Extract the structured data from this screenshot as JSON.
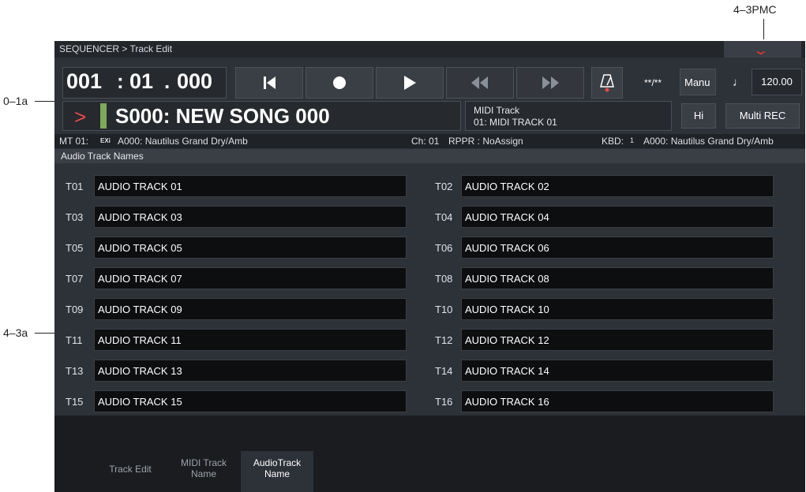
{
  "callouts": {
    "pmc": "4–3PMC",
    "song": "0–1a",
    "tracks": "4–3a"
  },
  "titlebar": {
    "title": "SEQUENCER > Track Edit",
    "pmc_icon": "chevron-down-icon"
  },
  "locator": {
    "measure": "001",
    "beat": "01",
    "tick": "000",
    "colon": ":",
    "dot": "."
  },
  "transport": {
    "meter": "**/**",
    "mode": "Manu",
    "note_symbol": "♩",
    "tempo": "120.00"
  },
  "song": {
    "chevron": ">",
    "name": "S000: NEW SONG 000"
  },
  "midi_track": {
    "label": "MIDI Track",
    "value": "01: MIDI TRACK 01"
  },
  "buttons": {
    "hi": "Hi",
    "multi_rec": "Multi REC"
  },
  "info": {
    "mt": "MT 01:",
    "exi": "EXi",
    "program": "A000: Nautilus Grand Dry/Amb",
    "channel": "Ch: 01",
    "rppr": "RPPR : NoAssign",
    "kbd": "KBD:",
    "kbd_num": "1",
    "kbd_program": "A000: Nautilus Grand Dry/Amb"
  },
  "section_title": "Audio Track Names",
  "tracks": [
    {
      "id": "T01",
      "name": "AUDIO TRACK 01"
    },
    {
      "id": "T02",
      "name": "AUDIO TRACK 02"
    },
    {
      "id": "T03",
      "name": "AUDIO TRACK 03"
    },
    {
      "id": "T04",
      "name": "AUDIO TRACK 04"
    },
    {
      "id": "T05",
      "name": "AUDIO TRACK 05"
    },
    {
      "id": "T06",
      "name": "AUDIO TRACK 06"
    },
    {
      "id": "T07",
      "name": "AUDIO TRACK 07"
    },
    {
      "id": "T08",
      "name": "AUDIO TRACK 08"
    },
    {
      "id": "T09",
      "name": "AUDIO TRACK 09"
    },
    {
      "id": "T10",
      "name": "AUDIO TRACK 10"
    },
    {
      "id": "T11",
      "name": "AUDIO TRACK 11"
    },
    {
      "id": "T12",
      "name": "AUDIO TRACK 12"
    },
    {
      "id": "T13",
      "name": "AUDIO TRACK 13"
    },
    {
      "id": "T14",
      "name": "AUDIO TRACK 14"
    },
    {
      "id": "T15",
      "name": "AUDIO TRACK 15"
    },
    {
      "id": "T16",
      "name": "AUDIO TRACK 16"
    }
  ],
  "tabs": [
    {
      "line1": "Track Edit",
      "line2": ""
    },
    {
      "line1": "MIDI Track",
      "line2": "Name"
    },
    {
      "line1": "AudioTrack",
      "line2": "Name"
    }
  ],
  "colors": {
    "accent_red": "#e84a4a",
    "song_bar": "#7ea85a",
    "screen_bg": "#2d3138"
  }
}
